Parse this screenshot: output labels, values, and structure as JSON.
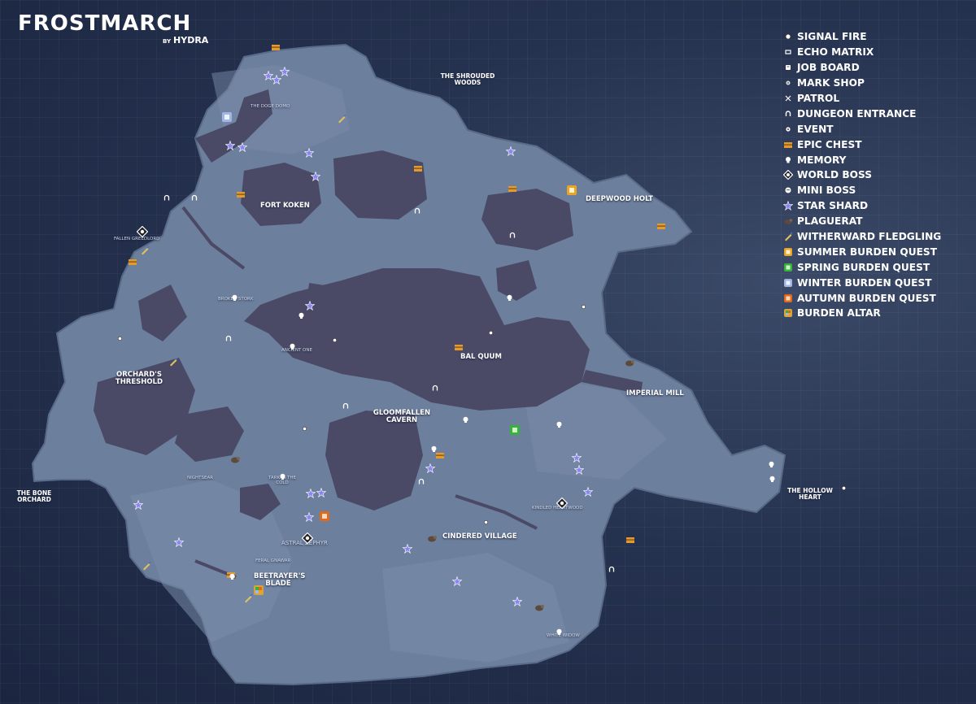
{
  "title": "FROSTMARCH",
  "byline_prefix": "BY",
  "author": "HYDRA",
  "colors": {
    "background": "#22304d",
    "land": "#6c7f9d",
    "land_light": "#7a8ca9",
    "water": "#4a4a67",
    "label": "#ffffff"
  },
  "locations": [
    {
      "name": "FORT KOKEN",
      "size": "big"
    },
    {
      "name": "THE SHROUDED WOODS",
      "size": "off"
    },
    {
      "name": "DEEPWOOD HOLT",
      "size": "big"
    },
    {
      "name": "FALLEN GREEDLORD",
      "size": "small"
    },
    {
      "name": "BAL QUUM",
      "size": "big"
    },
    {
      "name": "ORCHARD'S THRESHOLD",
      "size": "big"
    },
    {
      "name": "IMPERIAL MILL",
      "size": "big"
    },
    {
      "name": "GLOOMFALLEN CAVERN",
      "size": "big"
    },
    {
      "name": "THE BONE ORCHARD",
      "size": "off"
    },
    {
      "name": "THE HOLLOW HEART",
      "size": "off"
    },
    {
      "name": "KINDLED HEARTWOOD",
      "size": "small"
    },
    {
      "name": "ASTRAL ZEPHYR",
      "size": "small"
    },
    {
      "name": "CINDERED VILLAGE",
      "size": "big"
    },
    {
      "name": "BEETRAYER'S BLADE",
      "size": "big"
    },
    {
      "name": "THE DOGE DOMO",
      "size": "small"
    },
    {
      "name": "BROKEN STORK",
      "size": "small"
    },
    {
      "name": "ANCIENT ONE",
      "size": "small"
    },
    {
      "name": "NIGHTSEAR",
      "size": "small"
    },
    {
      "name": "TARKAS THE COLD",
      "size": "small"
    },
    {
      "name": "FERAL GNAWAR",
      "size": "small"
    },
    {
      "name": "WHITE WIDOW",
      "size": "small"
    }
  ],
  "legend": [
    {
      "icon": "signal-fire-icon",
      "label": "SIGNAL FIRE"
    },
    {
      "icon": "echo-matrix-icon",
      "label": "ECHO MATRIX"
    },
    {
      "icon": "job-board-icon",
      "label": "JOB BOARD"
    },
    {
      "icon": "mark-shop-icon",
      "label": "MARK SHOP"
    },
    {
      "icon": "patrol-icon",
      "label": "PATROL"
    },
    {
      "icon": "dungeon-entrance-icon",
      "label": "DUNGEON ENTRANCE"
    },
    {
      "icon": "event-icon",
      "label": "EVENT"
    },
    {
      "icon": "epic-chest-icon",
      "label": "EPIC CHEST"
    },
    {
      "icon": "memory-icon",
      "label": "MEMORY"
    },
    {
      "icon": "world-boss-icon",
      "label": "WORLD BOSS"
    },
    {
      "icon": "mini-boss-icon",
      "label": "MINI BOSS"
    },
    {
      "icon": "star-shard-icon",
      "label": "STAR SHARD"
    },
    {
      "icon": "plaguerat-icon",
      "label": "PLAGUERAT"
    },
    {
      "icon": "witherward-fledgling-icon",
      "label": "WITHERWARD FLEDGLING"
    },
    {
      "icon": "summer-burden-quest-icon",
      "label": "SUMMER BURDEN QUEST",
      "color": "#e8a52a"
    },
    {
      "icon": "spring-burden-quest-icon",
      "label": "SPRING BURDEN QUEST",
      "color": "#37b23a"
    },
    {
      "icon": "winter-burden-quest-icon",
      "label": "WINTER BURDEN QUEST",
      "color": "#9fb6e6"
    },
    {
      "icon": "autumn-burden-quest-icon",
      "label": "AUTUMN BURDEN QUEST",
      "color": "#e06a1c"
    },
    {
      "icon": "burden-altar-icon",
      "label": "BURDEN ALTAR",
      "color": "#d8a43a"
    }
  ]
}
